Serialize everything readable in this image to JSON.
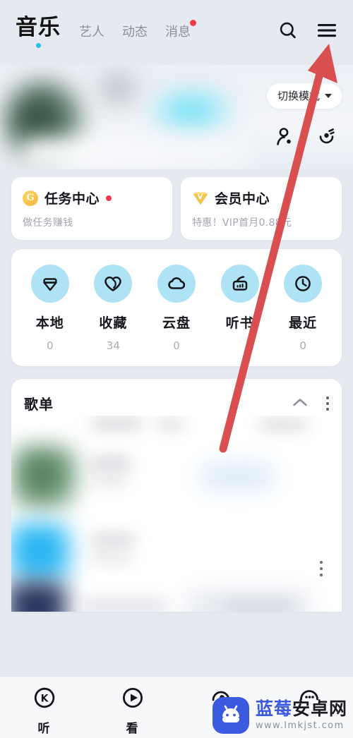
{
  "header": {
    "brand": "音乐",
    "tabs": [
      {
        "label": "艺人",
        "badge": false
      },
      {
        "label": "动态",
        "badge": false
      },
      {
        "label": "消息",
        "badge": true
      }
    ],
    "actions": [
      {
        "name": "search-icon",
        "label": "搜索"
      },
      {
        "name": "hamburger-menu-icon",
        "label": "菜单"
      }
    ]
  },
  "profile": {
    "mode_button": "切换模式",
    "icons": [
      {
        "name": "add-friend-icon"
      },
      {
        "name": "scan-check-icon"
      }
    ]
  },
  "promos": [
    {
      "badge": "G",
      "title": "任务中心",
      "has_dot": true,
      "subtitle": "做任务赚钱"
    },
    {
      "badge": "V",
      "title": "会员中心",
      "has_dot": false,
      "subtitle": "特惠！VIP首月0.88元"
    }
  ],
  "quick_access": {
    "items": [
      {
        "icon": "download-local-icon",
        "label": "本地",
        "count": "0"
      },
      {
        "icon": "heart-favorite-icon",
        "label": "收藏",
        "count": "34"
      },
      {
        "icon": "cloud-drive-icon",
        "label": "云盘",
        "count": "0"
      },
      {
        "icon": "radio-audiobook-icon",
        "label": "听书",
        "count": "·"
      },
      {
        "icon": "clock-recent-icon",
        "label": "最近",
        "count": "0"
      }
    ]
  },
  "playlist": {
    "title": "歌单",
    "collapse_icon": "chevron-up-icon",
    "more_icon": "more-vertical-icon"
  },
  "bottom_nav": {
    "items": [
      {
        "icon": "karaoke-k-icon",
        "label": "听"
      },
      {
        "icon": "play-circle-icon",
        "label": "看"
      },
      {
        "icon": "headphone-icon",
        "label": ""
      },
      {
        "icon": "smiley-icon",
        "label": ""
      }
    ]
  },
  "watermark": {
    "title_blue": "蓝莓",
    "title_dark": "安卓网",
    "url": "www.lmkjst.com",
    "logo": "android-robot-icon"
  },
  "annotation": {
    "type": "arrow",
    "color": "#d94f4f",
    "points_to": "hamburger-menu-icon"
  },
  "colors": {
    "page_bg": "#e6e9f0",
    "card_bg": "#ffffff",
    "accent_blue": "#aee2f5",
    "brand_dot": "#23c2e8",
    "badge_red": "#f0394d",
    "text_primary": "#16181d",
    "text_muted": "#a3a6ae",
    "watermark_blue": "#3c5ae0"
  }
}
